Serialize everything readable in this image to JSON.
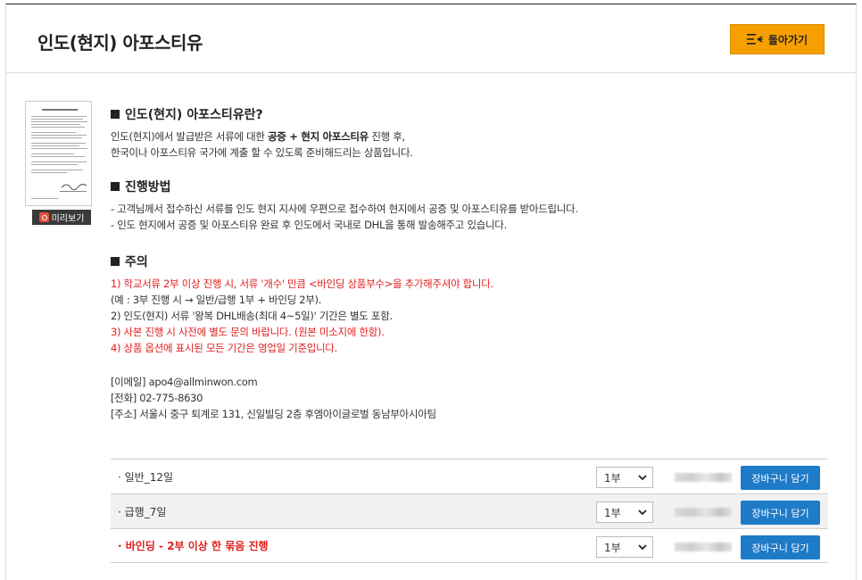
{
  "page": {
    "title": "인도(현지) 아포스티유",
    "back_label": "돌아가기"
  },
  "preview": {
    "label": "미리보기"
  },
  "intro": {
    "title": "인도(현지) 아포스티유란?",
    "line1_pre": "인도(현지)에서 발급받은 서류에 대한 ",
    "line1_bold": "공증 + 현지 아포스티유",
    "line1_post": " 진행 후,",
    "line2": "한국이나 아포스티유 국가에 계출 할 수 있도록 준비해드리는 상품입니다."
  },
  "process": {
    "title": "진행방법",
    "lines": [
      "- 고객님께서 접수하신 서류를 인도 현지 지사에 우편으로 접수하여 현지에서 공증 및 아포스티유를 받아드립니다.",
      "- 인도 현지에서 공증 및 아포스티유 완료 후 인도에서 국내로 DHL을 통해 발송해주고 있습니다."
    ]
  },
  "caution": {
    "title": "주의",
    "lines": [
      {
        "text": "1) 학교서류 2부 이상 진행 시, 서류 '개수' 만큼 <바인딩 상품부수>을 추가해주셔야 합니다.",
        "color": "#e02020"
      },
      {
        "text": "(예 : 3부 진행 시 → 일반/급행 1부 + 바인딩 2부).",
        "color": "#333333"
      },
      {
        "text": "2) 인도(현지) 서류 '왕복 DHL배송(최대 4~5일)' 기간은 별도 포함.",
        "color": "#333333"
      },
      {
        "text": "3) 사본 진행 시 사전에 별도 문의 바랍니다. (원본 미소지에 한함).",
        "color": "#e02020"
      },
      {
        "text": "4) 상품 옵션에 표시된 모든 기간은 영업일 기준입니다.",
        "color": "#e02020"
      }
    ]
  },
  "contact": {
    "email": "[이메일] apo4@allminwon.com",
    "phone": "[전화] 02-775-8630",
    "address": "[주소] 서울시 중구 퇴계로 131, 신일빌딩 2층 후엠아이글로벌 동남부아시아팀"
  },
  "options": [
    {
      "label": "· 일반_12일",
      "qty": "1부",
      "cart": "장바구니 담기",
      "emphasis": false
    },
    {
      "label": "· 급행_7일",
      "qty": "1부",
      "cart": "장바구니 담기",
      "emphasis": false
    },
    {
      "label": "· 바인딩 - 2부 이상 한 묶음 진행",
      "qty": "1부",
      "cart": "장바구니 담기",
      "emphasis": true
    }
  ],
  "colors": {
    "accent": "#f5a000",
    "cart_button": "#1e7bc8",
    "warning": "#e02020"
  }
}
